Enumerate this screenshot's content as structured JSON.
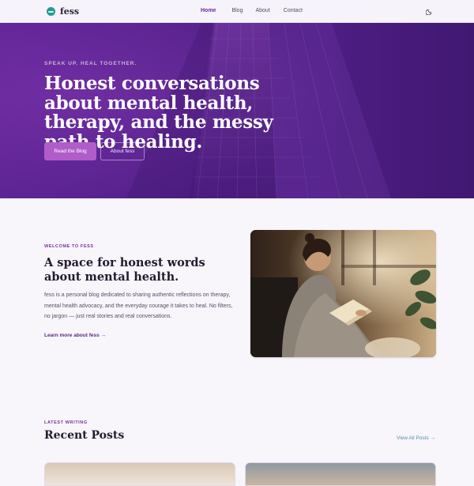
{
  "brand": {
    "name": "fess",
    "logo_icon": "teal-circle-logo-icon",
    "accent": "#6b2c92"
  },
  "nav": {
    "links": [
      "Home",
      "Blog",
      "About",
      "Contact"
    ],
    "active": "Home",
    "theme_icon": "moon-icon"
  },
  "hero": {
    "eyebrow": "SPEAK UP. HEAL TOGETHER.",
    "title": "Honest conversations about mental health, therapy, and the messy path to healing.",
    "primary_button": "Read the Blog",
    "secondary_button": "About fess"
  },
  "about": {
    "eyebrow": "WELCOME TO FESS",
    "title": "A space for honest words about mental health.",
    "body": "fess is a personal blog dedicated to sharing authentic reflections on therapy, mental health advocacy, and the everyday courage it takes to heal. No filters, no jargon — just real stories and real conversations.",
    "link": "Learn more about fess →"
  },
  "recent": {
    "eyebrow": "LATEST WRITING",
    "title": "Recent Posts",
    "view_all": "View All Posts →"
  },
  "colors": {
    "hero": "#54218a",
    "primary_button": "#b05cc9",
    "background": "#f8f5fb"
  }
}
